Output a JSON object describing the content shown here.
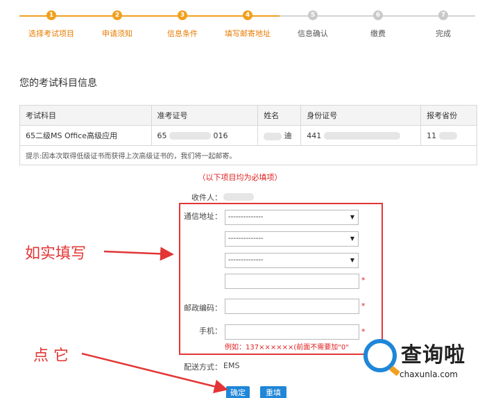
{
  "stepper": {
    "steps": [
      {
        "num": "1",
        "label": "选择考试项目"
      },
      {
        "num": "2",
        "label": "申请须知"
      },
      {
        "num": "3",
        "label": "信息条件"
      },
      {
        "num": "4",
        "label": "填写邮寄地址"
      },
      {
        "num": "5",
        "label": "信息确认"
      },
      {
        "num": "6",
        "label": "缴费"
      },
      {
        "num": "7",
        "label": "完成"
      }
    ],
    "done_color": "#f0a020",
    "todo_color": "#c9c9c9"
  },
  "section_title": "您的考试科目信息",
  "table": {
    "headers": [
      "考试科目",
      "准考证号",
      "姓名",
      "身份证号",
      "报考省份"
    ],
    "row": {
      "subject": "65二级MS Office高级应用",
      "ticket_prefix": "65",
      "ticket_suffix": "016",
      "name_suffix": "迪",
      "id_prefix": "441",
      "province_prefix": "11"
    },
    "note": "提示:因本次取得低级证书而获得上次高级证书的，我们将一起邮寄。"
  },
  "form": {
    "required_tip": "（以下项目均为必填项）",
    "recipient_label": "收件人：",
    "address_label": "通信地址：",
    "select_placeholder": "--------------",
    "postcode_label": "邮政编码：",
    "phone_label": "手机：",
    "required_mark": "*",
    "phone_hint": "例如：137××××××(前面不需要加\"0\"",
    "delivery_label": "配送方式：",
    "delivery_value": "EMS"
  },
  "buttons": {
    "confirm": "确定",
    "reset": "重填"
  },
  "annotations": {
    "fill_truthfully": "如实填写",
    "click_it": "点 它"
  },
  "watermark": {
    "brand": "查询啦",
    "domain": "chaxunla.com"
  },
  "colors": {
    "accent_orange": "#e77b00",
    "annotation_red": "#e33535",
    "button_blue": "#1f86d8"
  }
}
